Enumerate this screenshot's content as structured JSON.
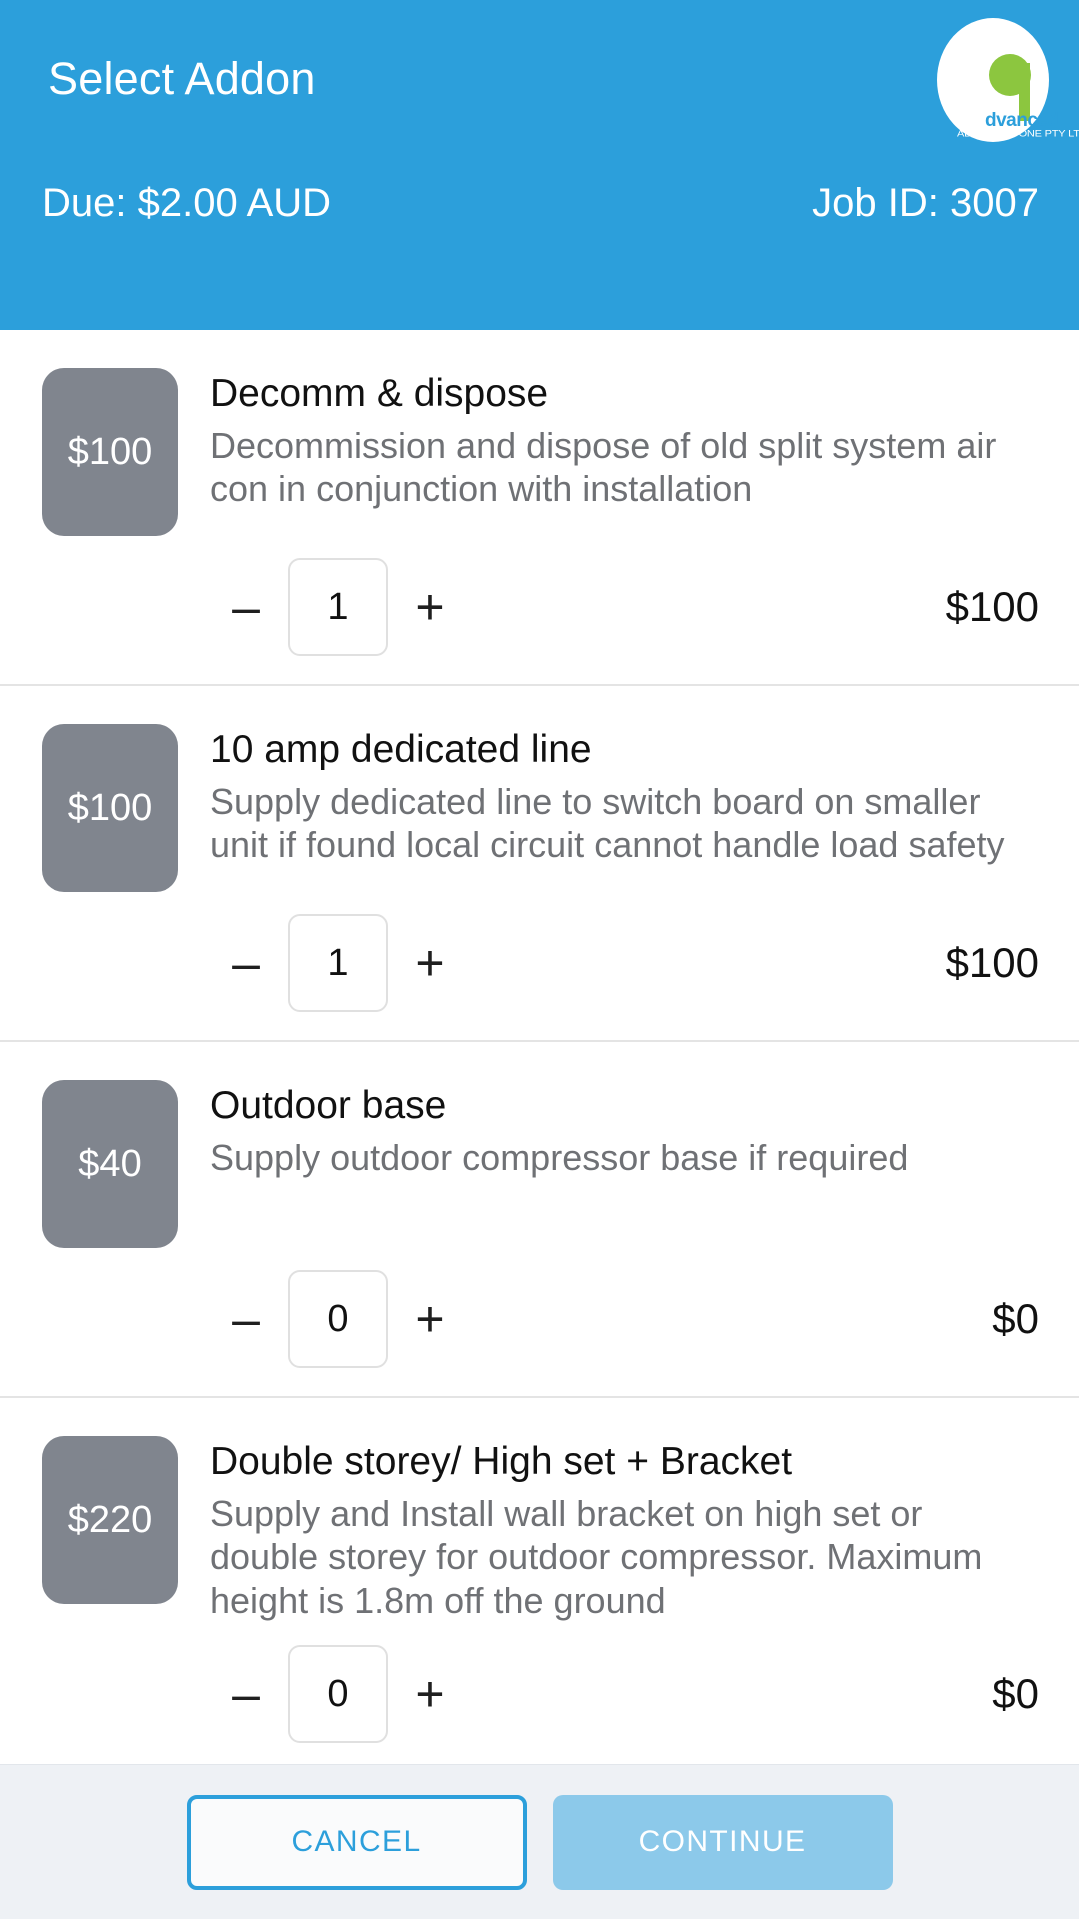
{
  "header": {
    "title": "Select Addon",
    "due_label": "Due: $2.00 AUD",
    "job_label": "Job ID: 3007",
    "accent_color": "#2C9FDB",
    "logo": {
      "wordmark": "dvanced",
      "legal_name": "ADVANCED ONE PTY LTD",
      "mark_color": "#8CC63F"
    }
  },
  "addons": [
    {
      "badge_price": "$100",
      "title": "Decomm & dispose",
      "description": "Decommission and dispose of old split system air con in conjunction with installation",
      "decrement_label": "–",
      "increment_label": "+",
      "quantity": "1",
      "line_total": "$100"
    },
    {
      "badge_price": "$100",
      "title": "10 amp dedicated line",
      "description": "Supply dedicated line to switch board on smaller unit if found local circuit cannot handle load safety",
      "decrement_label": "–",
      "increment_label": "+",
      "quantity": "1",
      "line_total": "$100"
    },
    {
      "badge_price": "$40",
      "title": "Outdoor base",
      "description": "Supply outdoor compressor base if required",
      "decrement_label": "–",
      "increment_label": "+",
      "quantity": "0",
      "line_total": "$0"
    },
    {
      "badge_price": "$220",
      "title": "Double storey/ High set + Bracket",
      "description": "Supply and Install wall bracket on high set or double storey for outdoor compressor. Maximum height is 1.8m off the ground",
      "decrement_label": "–",
      "increment_label": "+",
      "quantity": "0",
      "line_total": "$0"
    }
  ],
  "footer": {
    "cancel_label": "CANCEL",
    "continue_label": "CONTINUE",
    "cancel_color": "#2C9FDB",
    "continue_color": "#8CC9EA"
  }
}
